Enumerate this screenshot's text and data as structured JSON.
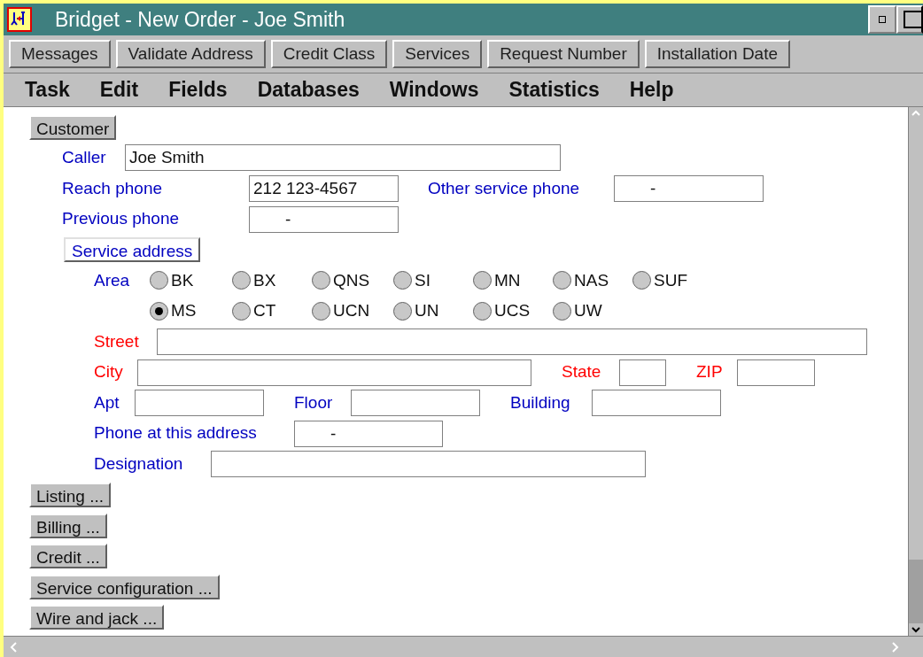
{
  "window": {
    "title": "Bridget - New Order - Joe Smith"
  },
  "toolbar": [
    "Messages",
    "Validate Address",
    "Credit Class",
    "Services",
    "Request Number",
    "Installation Date"
  ],
  "menu": [
    "Task",
    "Edit",
    "Fields",
    "Databases",
    "Windows",
    "Statistics",
    "Help"
  ],
  "customer": {
    "button": "Customer",
    "caller": {
      "label": "Caller",
      "value": "Joe Smith"
    },
    "reach_phone": {
      "label": "Reach phone",
      "value": "212 123-4567"
    },
    "other_service_phone": {
      "label": "Other service phone",
      "value": "-"
    },
    "previous_phone": {
      "label": "Previous phone",
      "value": "-"
    }
  },
  "service_address": {
    "button": "Service address",
    "area": {
      "label": "Area",
      "options": [
        {
          "label": "BK",
          "selected": false
        },
        {
          "label": "BX",
          "selected": false
        },
        {
          "label": "QNS",
          "selected": false
        },
        {
          "label": "SI",
          "selected": false
        },
        {
          "label": "MN",
          "selected": false
        },
        {
          "label": "NAS",
          "selected": false
        },
        {
          "label": "SUF",
          "selected": false
        },
        {
          "label": "MS",
          "selected": true
        },
        {
          "label": "CT",
          "selected": false
        },
        {
          "label": "UCN",
          "selected": false
        },
        {
          "label": "UN",
          "selected": false
        },
        {
          "label": "UCS",
          "selected": false
        },
        {
          "label": "UW",
          "selected": false
        }
      ]
    },
    "street": {
      "label": "Street",
      "required": true
    },
    "city": {
      "label": "City",
      "required": true
    },
    "state": {
      "label": "State",
      "required": true
    },
    "zip": {
      "label": "ZIP",
      "required": true
    },
    "apt": {
      "label": "Apt",
      "required": false
    },
    "floor": {
      "label": "Floor",
      "required": false
    },
    "building": {
      "label": "Building",
      "required": false
    },
    "phone_at_address": {
      "label": "Phone at this address",
      "value": "-",
      "required": false
    },
    "designation": {
      "label": "Designation",
      "required": false
    }
  },
  "sections": [
    "Listing ...",
    "Billing ...",
    "Credit ...",
    "Service configuration ...",
    "Wire and jack ..."
  ]
}
